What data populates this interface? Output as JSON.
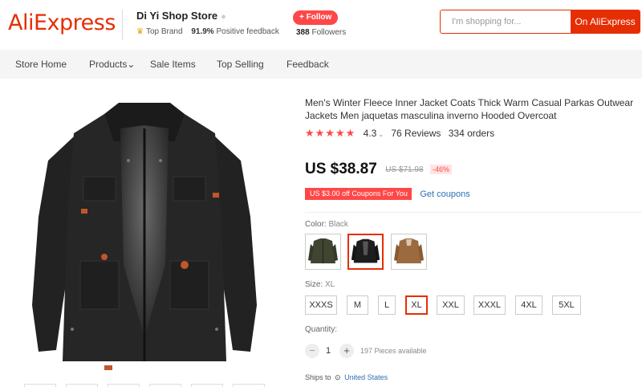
{
  "header": {
    "logo": "AliExpress",
    "store_name": "Di Yi Shop Store",
    "store_dot": "●",
    "top_brand": "Top Brand",
    "positive_pct": "91.9%",
    "positive_label": "Positive feedback",
    "follow_label": "+ Follow",
    "followers_count": "388",
    "followers_label": "Followers",
    "search_placeholder": "I'm shopping for...",
    "search_button": "On AliExpress"
  },
  "nav": {
    "items": [
      "Store Home",
      "Products",
      "Sale Items",
      "Top Selling",
      "Feedback"
    ],
    "products_caret": "⌄"
  },
  "product": {
    "title": "Men's Winter Fleece Inner Jacket Coats Thick Warm Casual Parkas Outwear Jackets Men jaquetas masculina inverno Hooded Overcoat",
    "stars": "★★★★★",
    "rating": "4.3",
    "rating_caret": "⌄",
    "reviews": "76 Reviews",
    "orders": "334 orders",
    "price": "US $38.87",
    "original_price": "US $71.98",
    "discount": "-46%",
    "coupon_tag": "US $3.00 off Coupons For You",
    "coupon_link": "Get coupons",
    "color_label": "Color:",
    "color_value": "Black",
    "colors": [
      {
        "name": "army-green",
        "hex": "#3f4530"
      },
      {
        "name": "black",
        "hex": "#1d1d1d"
      },
      {
        "name": "khaki",
        "hex": "#9b6b3f"
      }
    ],
    "selected_color_index": 1,
    "size_label": "Size:",
    "size_value": "XL",
    "sizes": [
      "XXXS",
      "M",
      "L",
      "XL",
      "XXL",
      "XXXL",
      "4XL",
      "5XL"
    ],
    "selected_size": "XL",
    "quantity_label": "Quantity:",
    "quantity": "1",
    "qty_minus": "−",
    "qty_plus": "+",
    "available": "197 Pieces available",
    "ships_to_label": "Ships to",
    "ships_to_icon": "⊙",
    "ships_to_country": "United States"
  },
  "colors": {
    "accent": "#e62e04",
    "follow": "#ff4747",
    "link": "#2e6fb3",
    "star": "#ff4747"
  }
}
